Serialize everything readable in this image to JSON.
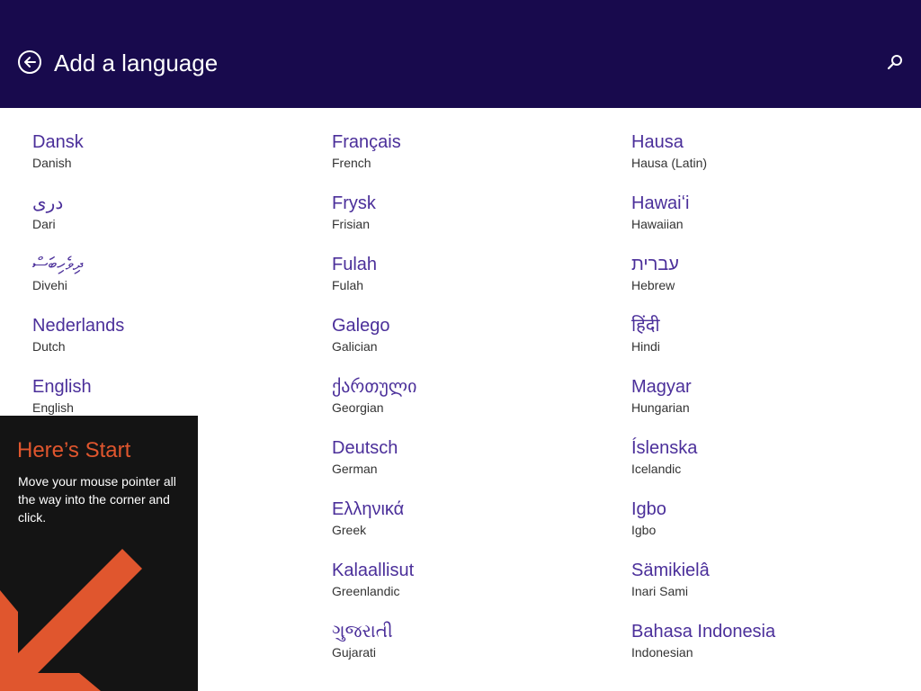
{
  "header": {
    "title": "Add a language",
    "back_icon": "back-arrow-circle-icon",
    "search_icon": "search-icon",
    "background_color": "#180a4d"
  },
  "languages": {
    "columns": [
      [
        {
          "native": "Dansk",
          "english": "Danish"
        },
        {
          "native": "دری",
          "english": "Dari"
        },
        {
          "native": "ދިވެހިބަސް",
          "english": "Divehi"
        },
        {
          "native": "Nederlands",
          "english": "Dutch"
        },
        {
          "native": "English",
          "english": "English"
        }
      ],
      [
        {
          "native": "Français",
          "english": "French"
        },
        {
          "native": "Frysk",
          "english": "Frisian"
        },
        {
          "native": "Fulah",
          "english": "Fulah"
        },
        {
          "native": "Galego",
          "english": "Galician"
        },
        {
          "native": "ქართული",
          "english": "Georgian"
        },
        {
          "native": "Deutsch",
          "english": "German"
        },
        {
          "native": "Ελληνικά",
          "english": "Greek"
        },
        {
          "native": "Kalaallisut",
          "english": "Greenlandic"
        },
        {
          "native": "ગુજરાતી",
          "english": "Gujarati"
        }
      ],
      [
        {
          "native": "Hausa",
          "english": "Hausa (Latin)"
        },
        {
          "native": "Hawaiʻi",
          "english": "Hawaiian"
        },
        {
          "native": "עברית",
          "english": "Hebrew"
        },
        {
          "native": "हिंदी",
          "english": "Hindi"
        },
        {
          "native": "Magyar",
          "english": "Hungarian"
        },
        {
          "native": "Íslenska",
          "english": "Icelandic"
        },
        {
          "native": "Igbo",
          "english": "Igbo"
        },
        {
          "native": "Sämikielâ",
          "english": "Inari Sami"
        },
        {
          "native": "Bahasa Indonesia",
          "english": "Indonesian"
        }
      ]
    ],
    "native_color": "#4b2f9a",
    "english_color": "#333333"
  },
  "start_tip": {
    "title": "Here’s Start",
    "body": "Move your mouse pointer all the way into the corner and click.",
    "arrow_icon": "corner-arrow-icon",
    "accent_color": "#e0562e",
    "background_color": "#141414"
  }
}
